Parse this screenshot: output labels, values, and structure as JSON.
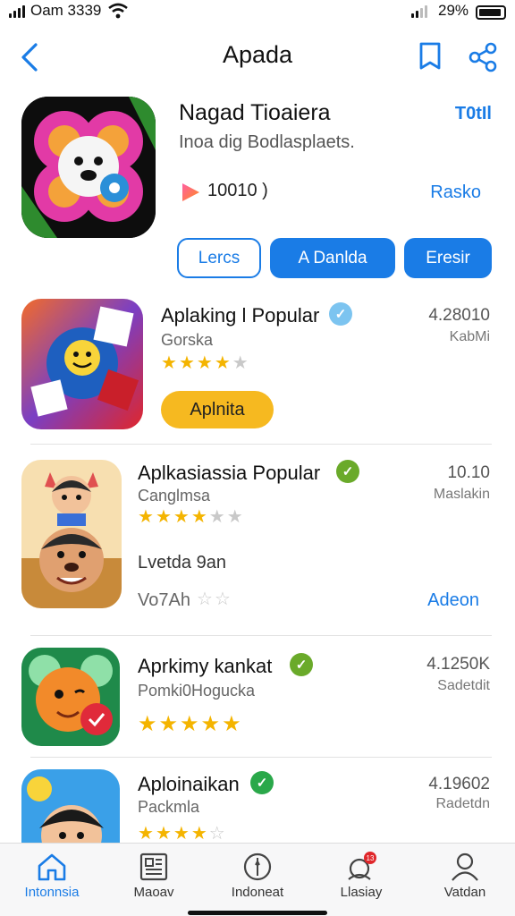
{
  "status_bar": {
    "carrier": "Oam 3339",
    "battery": "29%"
  },
  "nav": {
    "title": "Apada"
  },
  "featured": {
    "title": "Nagad Tioaiera",
    "badge": "T0tIl",
    "subtitle": "Inoa dig Bodlasplaets.",
    "count": "10010 )",
    "link": "Rasko",
    "buttons": [
      "Lercs",
      "A Danlda",
      "Eresir"
    ]
  },
  "apps": [
    {
      "title": "Aplaking l Popular",
      "subtitle": "Gorska",
      "meta1": "4.28010",
      "meta2": "KabMi",
      "rating": 4,
      "install": "Aplnita",
      "verified_color": "#7cc4f0"
    },
    {
      "title": "Aplkasiassia Popular",
      "subtitle": "Canglmsa",
      "meta1": "10.10",
      "meta2": "Maslakin",
      "rating": 3.5,
      "extra_line": "Lvetda 9an",
      "extra_small": "Vo7Ah",
      "link": "Adeon",
      "verified_color": "#6aaa2a"
    },
    {
      "title": "Aprkimy kankat",
      "subtitle": "Pomki0Hogucka",
      "meta1": "4.1250K",
      "meta2": "Sadetdit",
      "rating": 5,
      "verified_color": "#6aaa2a"
    },
    {
      "title": "Aploinaikan",
      "subtitle": "Packmla",
      "meta1": "4.19602",
      "meta2": "Radetdn",
      "rating": 4,
      "verified_color": "#2aa84a"
    }
  ],
  "tabs": [
    {
      "label": "Intonnsia",
      "icon": "home-icon"
    },
    {
      "label": "Maoav",
      "icon": "news-icon"
    },
    {
      "label": "Indoneat",
      "icon": "compass-icon"
    },
    {
      "label": "Llasiay",
      "icon": "notification-icon",
      "badge": "13"
    },
    {
      "label": "Vatdan",
      "icon": "profile-icon"
    }
  ]
}
